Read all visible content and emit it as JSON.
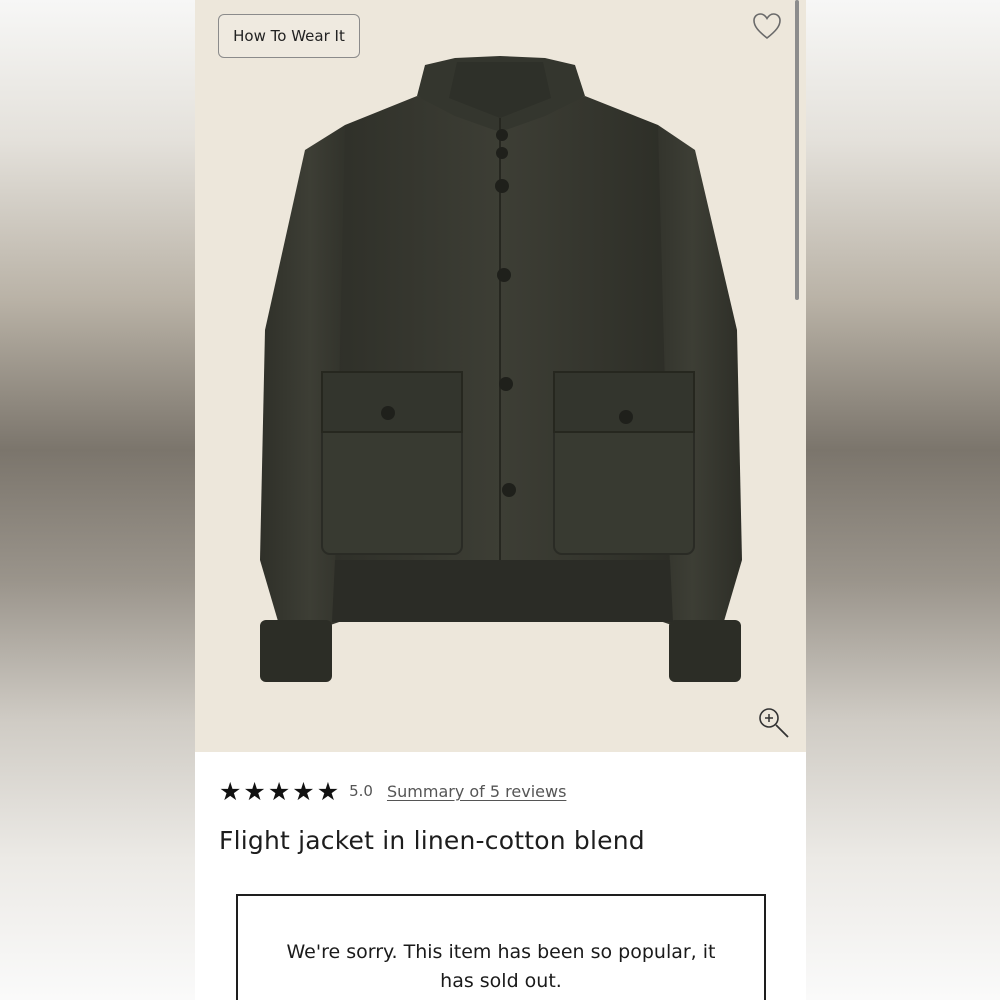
{
  "hero": {
    "how_to_wear_label": "How To Wear It",
    "favorite_icon": "heart-outline-icon",
    "zoom_icon": "zoom-in-icon",
    "background_color": "#ede7db",
    "jacket_color": "#3b3c33"
  },
  "rating": {
    "star_icon": "star-filled-icon",
    "stars": [
      "★",
      "★",
      "★",
      "★",
      "★"
    ],
    "value": "5.0",
    "reviews_link": "Summary of 5 reviews"
  },
  "product": {
    "title": "Flight jacket in linen-cotton blend"
  },
  "availability": {
    "line1": "We're sorry. This item has been so popular, it",
    "line2": "has sold out."
  }
}
